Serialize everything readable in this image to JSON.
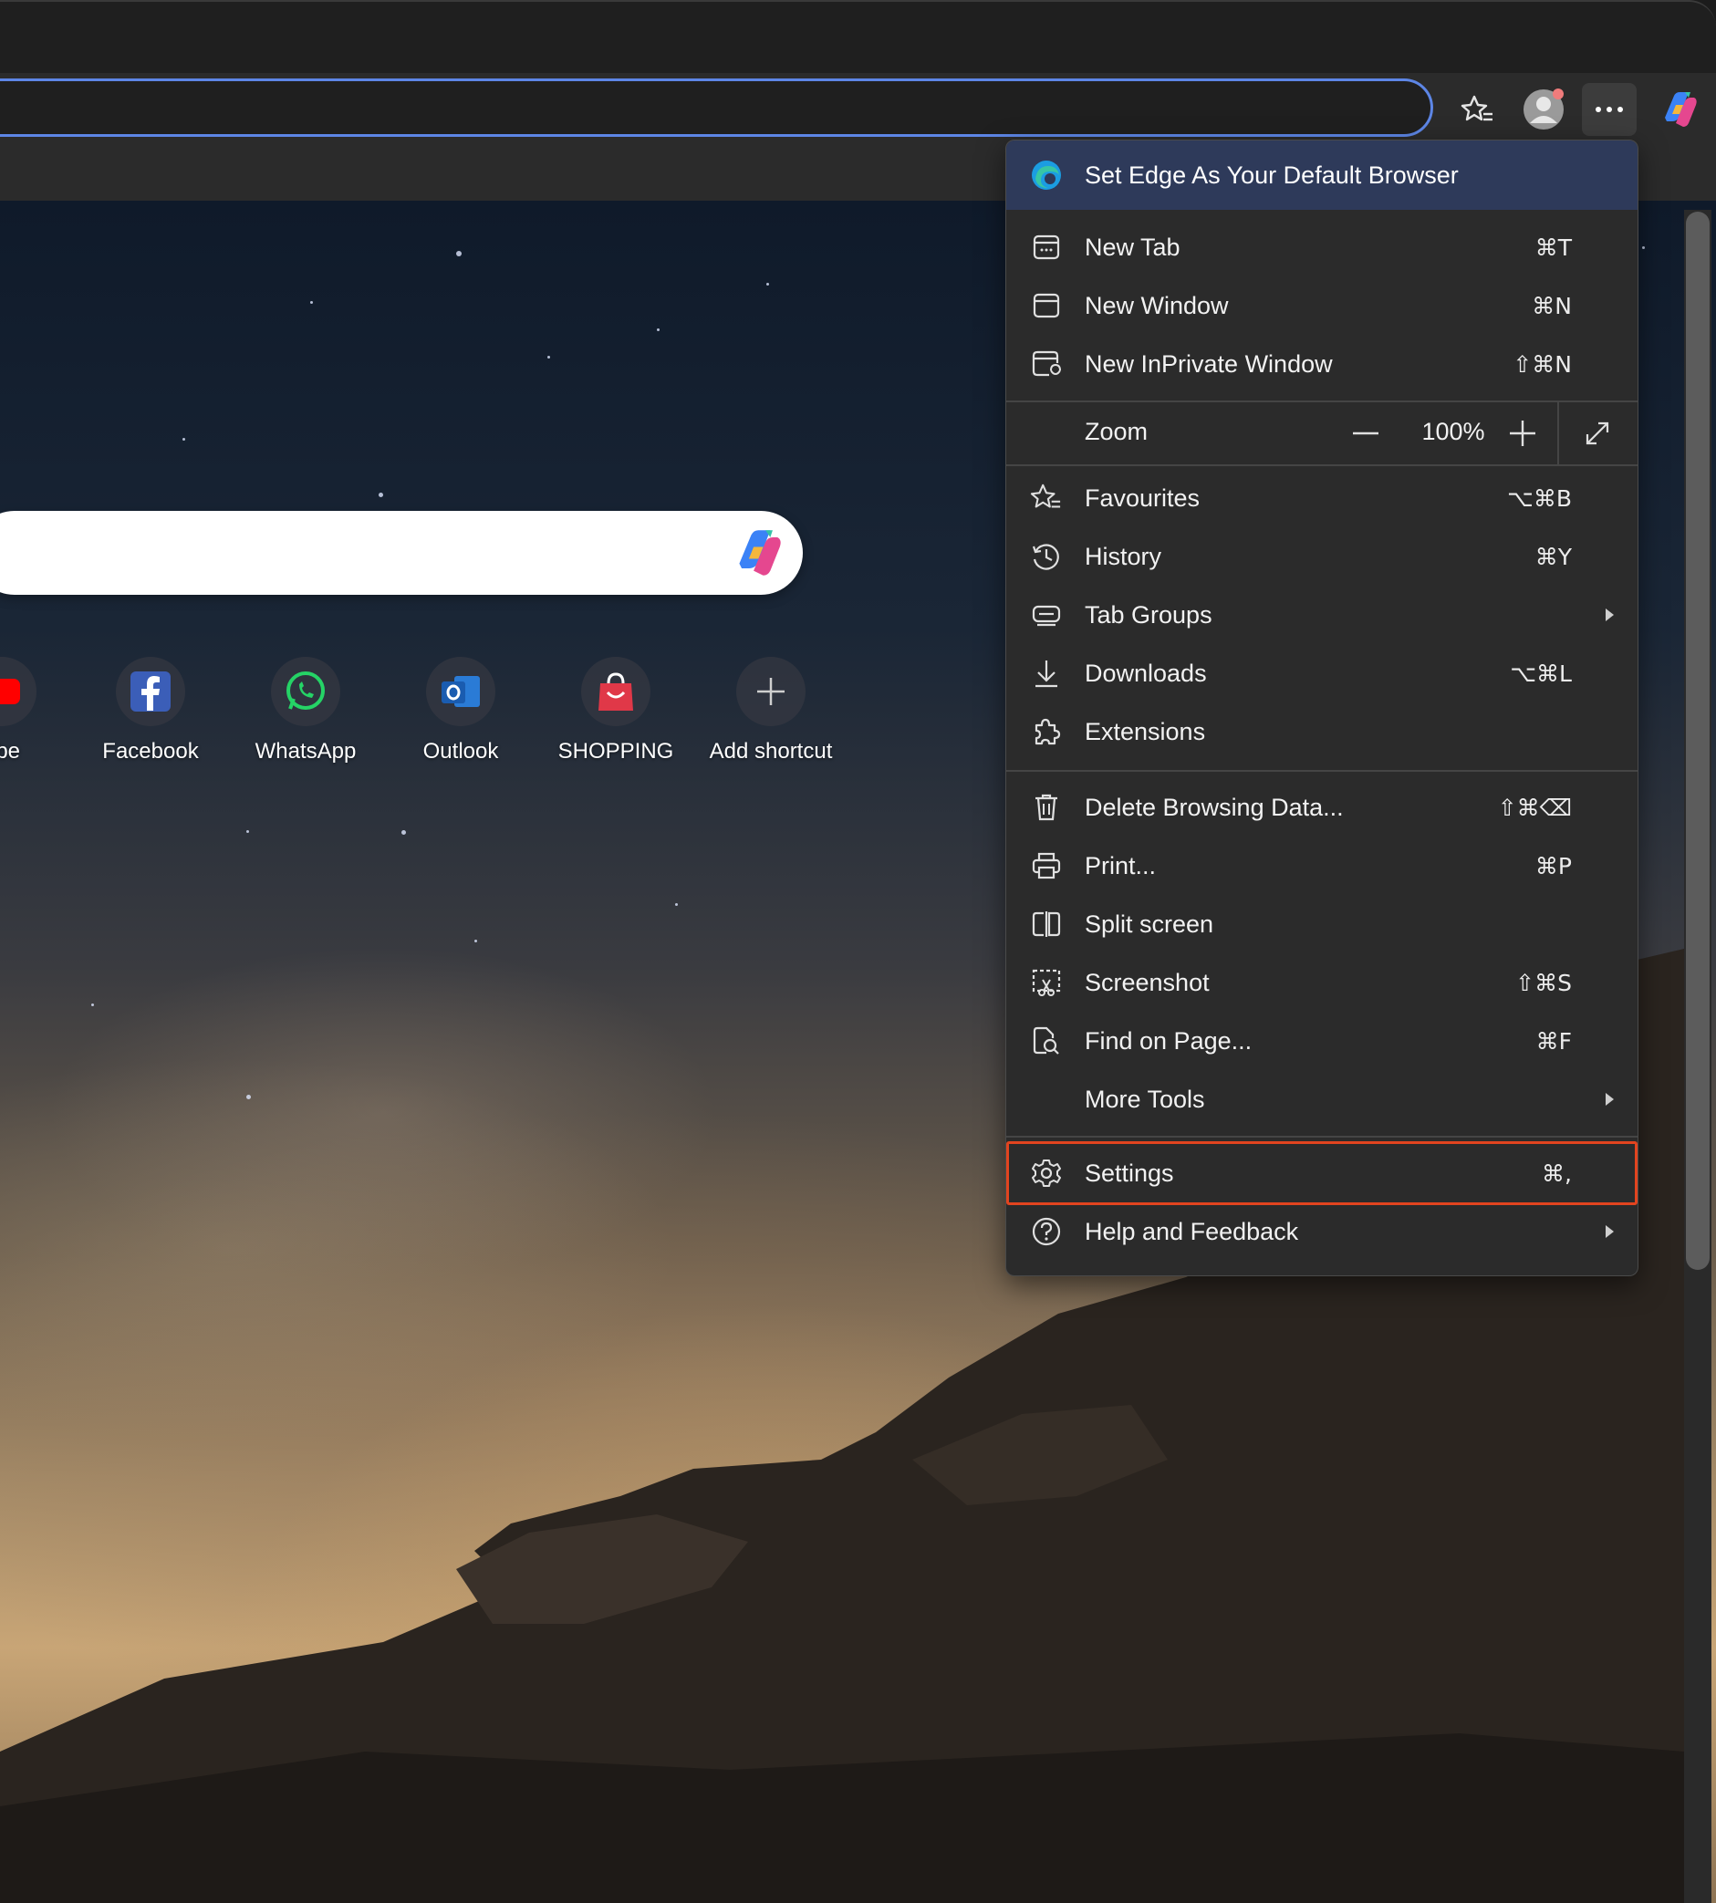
{
  "menu": {
    "banner": "Set Edge As Your Default Browser",
    "new_tab": {
      "label": "New Tab",
      "shortcut": "⌘T"
    },
    "new_window": {
      "label": "New Window",
      "shortcut": "⌘N"
    },
    "new_inprivate": {
      "label": "New InPrivate Window",
      "shortcut": "⇧⌘N"
    },
    "zoom": {
      "label": "Zoom",
      "value": "100%"
    },
    "favourites": {
      "label": "Favourites",
      "shortcut": "⌥⌘B"
    },
    "history": {
      "label": "History",
      "shortcut": "⌘Y"
    },
    "tab_groups": {
      "label": "Tab Groups"
    },
    "downloads": {
      "label": "Downloads",
      "shortcut": "⌥⌘L"
    },
    "extensions": {
      "label": "Extensions"
    },
    "delete_data": {
      "label": "Delete Browsing Data...",
      "shortcut": "⇧⌘⌫"
    },
    "print": {
      "label": "Print...",
      "shortcut": "⌘P"
    },
    "split_screen": {
      "label": "Split screen"
    },
    "screenshot": {
      "label": "Screenshot",
      "shortcut": "⇧⌘S"
    },
    "find": {
      "label": "Find on Page...",
      "shortcut": "⌘F"
    },
    "more_tools": {
      "label": "More Tools"
    },
    "settings": {
      "label": "Settings",
      "shortcut": "⌘,"
    },
    "help": {
      "label": "Help and Feedback"
    }
  },
  "shortcuts": [
    {
      "label": "ube"
    },
    {
      "label": "Facebook"
    },
    {
      "label": "WhatsApp"
    },
    {
      "label": "Outlook"
    },
    {
      "label": "SHOPPING"
    },
    {
      "label": "Add shortcut"
    }
  ],
  "colors": {
    "accent": "#5d86e6",
    "highlight": "#e2441f",
    "menu_bg": "#2b2b2b",
    "banner_bg": "#2e3a5a"
  }
}
